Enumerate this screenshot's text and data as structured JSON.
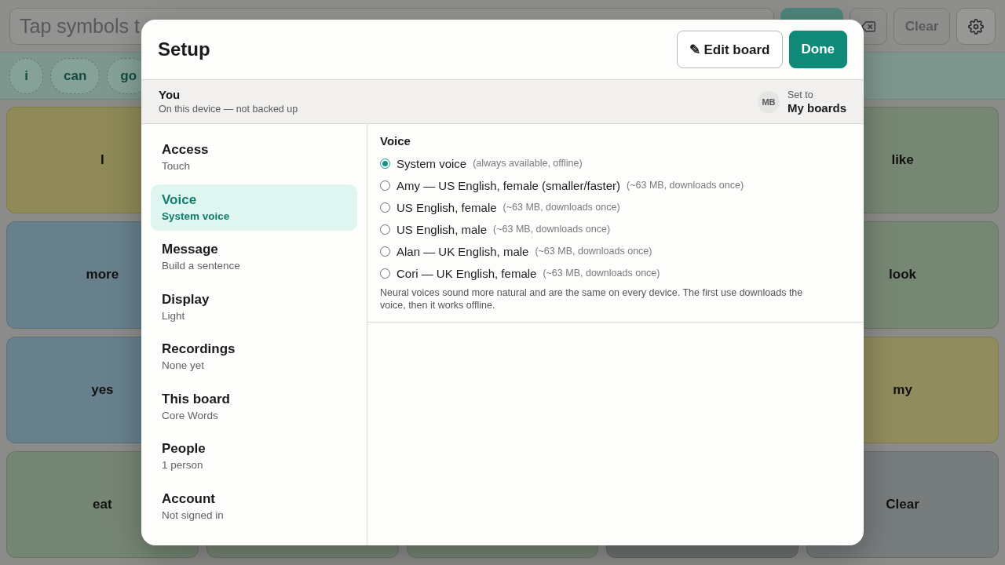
{
  "app_bar": {
    "message_field": {
      "placeholder": "Tap symbols t"
    },
    "buttons": [
      {
        "kind": "primary"
      },
      {
        "kind": "backspace"
      },
      {
        "kind": "text",
        "label": "Clear"
      },
      {
        "kind": "settings"
      }
    ]
  },
  "sentence": {
    "words": [
      "i",
      "can",
      "go"
    ]
  },
  "board": {
    "rows": [
      [
        {
          "label": "I",
          "color": "#8f8958"
        },
        null,
        null,
        null,
        {
          "label": "like",
          "color": "#768773"
        }
      ],
      [
        {
          "label": "more",
          "color": "#67808c"
        },
        null,
        null,
        null,
        {
          "label": "look",
          "color": "#768773"
        }
      ],
      [
        {
          "label": "yes",
          "color": "#67808c"
        },
        null,
        null,
        null,
        {
          "label": "my",
          "color": "#918c5d"
        }
      ],
      [
        {
          "label": "eat",
          "color": "#768674"
        },
        {
          "color": "#768674"
        },
        {
          "color": "#768674"
        },
        {
          "color": "#6f7272"
        },
        {
          "label": "Clear",
          "color": "#777c7c"
        }
      ]
    ]
  },
  "setup_dialog": {
    "title": "Setup",
    "actions": [
      {
        "kind": "secondary",
        "label": "✎ Edit board"
      },
      {
        "kind": "primary",
        "label": "Done"
      }
    ],
    "profile": {
      "name": "You",
      "status": "On this device — not backed up",
      "avatar_initials": "MB",
      "set_to_label": "Set to",
      "set_to_value": "My boards"
    },
    "sections": [
      {
        "title": "Access",
        "value": "Touch",
        "selected": false
      },
      {
        "title": "Voice",
        "value": "System voice",
        "selected": true
      },
      {
        "title": "Message",
        "value": "Build a sentence",
        "selected": false
      },
      {
        "title": "Display",
        "value": "Light",
        "selected": false
      },
      {
        "title": "Recordings",
        "value": "None yet",
        "selected": false
      },
      {
        "title": "This board",
        "value": "Core Words",
        "selected": false
      },
      {
        "title": "People",
        "value": "1 person",
        "selected": false
      },
      {
        "title": "Account",
        "value": "Not signed in",
        "selected": false
      }
    ],
    "voice_panel": {
      "heading": "Voice",
      "options": [
        {
          "label": "System voice",
          "note": "(always available, offline)",
          "selected": true
        },
        {
          "label": "Amy — US English, female (smaller/faster)",
          "note": "(~63 MB, downloads once)",
          "selected": false
        },
        {
          "label": "US English, female",
          "note": "(~63 MB, downloads once)",
          "selected": false
        },
        {
          "label": "US English, male",
          "note": "(~63 MB, downloads once)",
          "selected": false
        },
        {
          "label": "Alan — UK English, male",
          "note": "(~63 MB, downloads once)",
          "selected": false
        },
        {
          "label": "Cori — UK English, female",
          "note": "(~63 MB, downloads once)",
          "selected": false
        }
      ],
      "footnote": "Neural voices sound more natural and are the same on every device. The first use downloads the voice, then it works offline."
    }
  }
}
